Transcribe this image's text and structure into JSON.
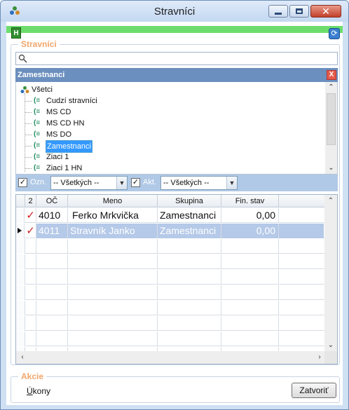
{
  "window": {
    "title": "Stravníci",
    "minimize_glyph": "",
    "close_glyph": "✕"
  },
  "toolbar": {
    "h_badge": "H"
  },
  "stravnici_group": {
    "title": "Stravníci",
    "search_value": "",
    "panel_header": "Zamestnanci",
    "panel_close": "X"
  },
  "tree": {
    "root_label": "Všetci",
    "items": [
      {
        "label": "Cudzí stravníci",
        "selected": false
      },
      {
        "label": "MS CD",
        "selected": false
      },
      {
        "label": "MS CD HN",
        "selected": false
      },
      {
        "label": "MS DO",
        "selected": false
      },
      {
        "label": "Zamestnanci",
        "selected": true
      },
      {
        "label": "Ziaci 1",
        "selected": false
      },
      {
        "label": "Ziaci 1 HN",
        "selected": false
      }
    ]
  },
  "filters": {
    "ozn_label": "Ozn.",
    "ozn_value": "-- Všetkých --",
    "ozn_checked": true,
    "akt_label": "Akt.",
    "akt_value": "-- Všetkých --",
    "akt_checked": true
  },
  "grid": {
    "columns": [
      "2",
      "OČ",
      "Meno",
      "Skupina",
      "Fin. stav"
    ],
    "rows": [
      {
        "checked": true,
        "oc": "4010",
        "meno": "Ferko Mrkvička",
        "skupina": "Zamestnanci",
        "fin_stav": "0,00",
        "selected": false
      },
      {
        "checked": true,
        "oc": "4011",
        "meno": "Stravník Janko",
        "skupina": "Zamestnanci",
        "fin_stav": "0,00",
        "selected": true
      }
    ],
    "empty_rows": 8
  },
  "akcie": {
    "title": "Akcie",
    "ukony_prefix": "Ú",
    "ukony_rest": "kony",
    "zatvorit_label": "Zatvoriť"
  },
  "colors": {
    "accent_orange": "#f2a66b",
    "panel_blue": "#6b8fbe",
    "selection_blue": "#3399ff",
    "strip_green": "#6cdd6c",
    "checkmark_red": "#cc2020"
  }
}
